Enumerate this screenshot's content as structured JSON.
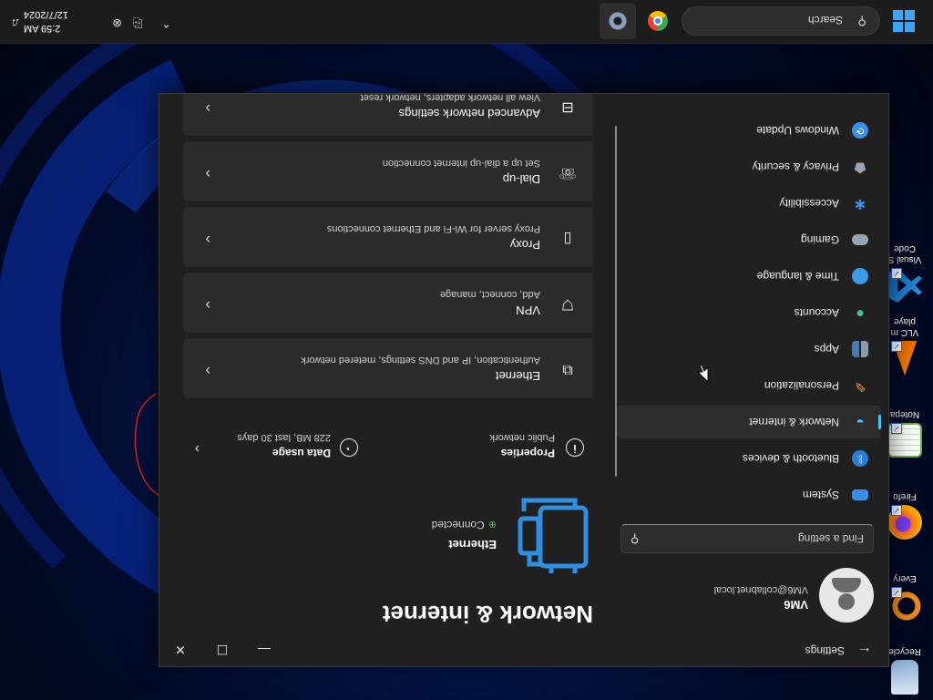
{
  "desktop": {
    "icons": [
      {
        "label": "Recycle",
        "icon": "recycle-bin-icon"
      },
      {
        "label": "Every",
        "icon": "everything-search-icon"
      },
      {
        "label": "Firefo",
        "icon": "firefox-icon"
      },
      {
        "label": "Notepa",
        "icon": "notepad-icon"
      },
      {
        "label": "VLC m",
        "label2": "playe",
        "icon": "vlc-icon"
      },
      {
        "label": "Visual S",
        "label2": "Code",
        "icon": "vscode-icon"
      }
    ]
  },
  "window": {
    "app_name": "Settings",
    "back_icon": "back-arrow-icon",
    "minimize_glyph": "—",
    "maximize_glyph": "☐",
    "close_glyph": "✕"
  },
  "profile": {
    "name": "VM6",
    "email": "VM6@collabnet.local"
  },
  "search": {
    "placeholder": "Find a setting"
  },
  "nav": {
    "items": [
      {
        "label": "System",
        "icon": "monitor-icon",
        "color": "#3a8ee6"
      },
      {
        "label": "Bluetooth & devices",
        "icon": "bluetooth-icon",
        "color": "#2a7fd4"
      },
      {
        "label": "Network & internet",
        "icon": "wifi-icon",
        "color": "#4cc2ff",
        "selected": true
      },
      {
        "label": "Personalization",
        "icon": "brush-icon",
        "color": "#e0a060"
      },
      {
        "label": "Apps",
        "icon": "apps-icon",
        "color": "#8a9aaa"
      },
      {
        "label": "Accounts",
        "icon": "person-icon",
        "color": "#3ac29a"
      },
      {
        "label": "Time & language",
        "icon": "globe-clock-icon",
        "color": "#3a9ae6"
      },
      {
        "label": "Gaming",
        "icon": "gamepad-icon",
        "color": "#9aa4ae"
      },
      {
        "label": "Accessibility",
        "icon": "accessibility-icon",
        "color": "#3a8ee6"
      },
      {
        "label": "Privacy & security",
        "icon": "shield-icon",
        "color": "#9aa4ae"
      },
      {
        "label": "Windows Update",
        "icon": "update-icon",
        "color": "#3a8ee6"
      }
    ]
  },
  "page": {
    "title": "Network & internet",
    "connection": {
      "name": "Ethernet",
      "status": "Connected",
      "icon": "ethernet-large-icon"
    },
    "properties": {
      "title": "Properties",
      "subtitle": "Public network",
      "icon": "info-icon"
    },
    "data_usage": {
      "title": "Data usage",
      "subtitle": "228 MB, last 30 days",
      "icon": "data-usage-icon"
    },
    "cards": [
      {
        "title": "Ethernet",
        "subtitle": "Authentication, IP and DNS settings, metered network",
        "icon": "ethernet-icon"
      },
      {
        "title": "VPN",
        "subtitle": "Add, connect, manage",
        "icon": "vpn-shield-icon"
      },
      {
        "title": "Proxy",
        "subtitle": "Proxy server for Wi-Fi and Ethernet connections",
        "icon": "proxy-icon"
      },
      {
        "title": "Dial-up",
        "subtitle": "Set up a dial-up internet connection",
        "icon": "dialup-icon"
      },
      {
        "title": "Advanced network settings",
        "subtitle": "View all network adapters, network reset",
        "icon": "advanced-network-icon"
      }
    ]
  },
  "taskbar": {
    "search_label": "Search",
    "apps": [
      {
        "name": "chrome",
        "icon": "chrome-icon"
      },
      {
        "name": "settings",
        "icon": "settings-gear-icon",
        "active": true
      }
    ],
    "time": "2:59 AM",
    "date": "12/7/2024"
  },
  "colors": {
    "accent": "#4cc2ff",
    "window_bg": "#202020",
    "card_bg": "#2b2b2b",
    "ethernet_icon": "#2f8fe0"
  }
}
